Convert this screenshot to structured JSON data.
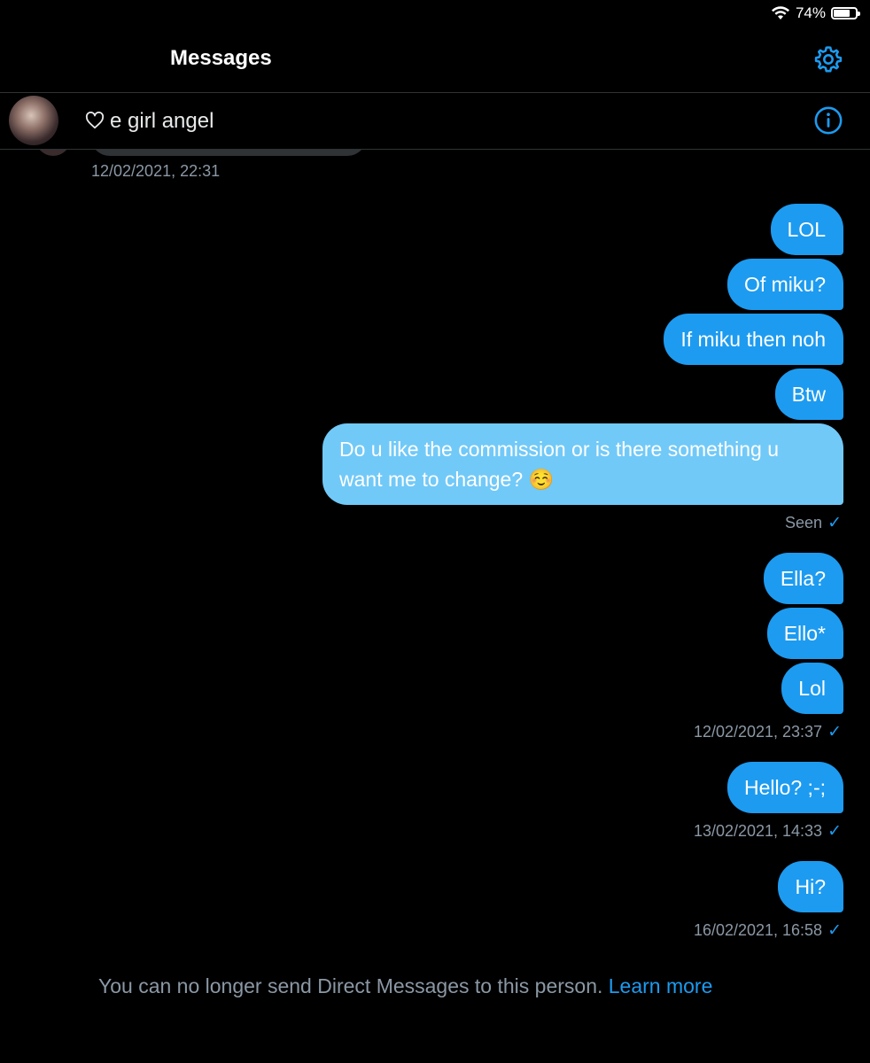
{
  "status_bar": {
    "battery_percent": "74%",
    "battery_level": 0.74,
    "wifi_icon": "wifi-icon"
  },
  "header": {
    "title": "Messages",
    "settings_icon": "gear-icon"
  },
  "conversation": {
    "name": "e girl angel",
    "name_icon": "heart-outline-icon",
    "info_icon": "info-circle-icon"
  },
  "previous_timestamp": "12/02/2021, 22:31",
  "messages": [
    {
      "text": "LOL"
    },
    {
      "text": "Of miku?"
    },
    {
      "text": "If miku then noh"
    },
    {
      "text": "Btw"
    },
    {
      "text": "Do u like the commission or is there something u want me to change? ☺️"
    },
    {
      "text": "Ella?"
    },
    {
      "text": "Ello*"
    },
    {
      "text": "Lol"
    },
    {
      "text": "Hello? ;-;"
    },
    {
      "text": "Hi?"
    }
  ],
  "meta": {
    "seen": "Seen",
    "ts1": "12/02/2021, 23:37",
    "ts2": "13/02/2021, 14:33",
    "ts3": "16/02/2021, 16:58",
    "check_glyph": "✓"
  },
  "footer": {
    "notice": "You can no longer send Direct Messages to this person.",
    "link": "Learn more"
  },
  "colors": {
    "accent": "#1d9bf0",
    "bubble_highlight": "#71c9f8",
    "secondary_text": "#8b98a5",
    "background": "#000000"
  }
}
